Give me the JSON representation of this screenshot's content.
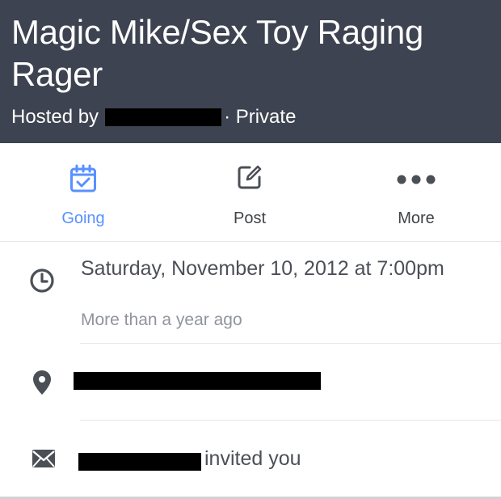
{
  "event": {
    "title": "Magic Mike/Sex Toy Raging Rager",
    "hosted_by_label": "Hosted by",
    "privacy": "· Private"
  },
  "actions": [
    {
      "label": "Going",
      "icon": "calendar-check-icon",
      "active": true
    },
    {
      "label": "Post",
      "icon": "compose-icon",
      "active": false
    },
    {
      "label": "More",
      "icon": "more-dots-icon",
      "active": false
    }
  ],
  "details": {
    "date": "Saturday, November 10, 2012 at 7:00pm",
    "relative_time": "More than a year ago",
    "invite_text": "invited you"
  },
  "colors": {
    "header_bg": "#3d4350",
    "accent": "#5890ff",
    "icon_gray": "#4b4f56"
  }
}
